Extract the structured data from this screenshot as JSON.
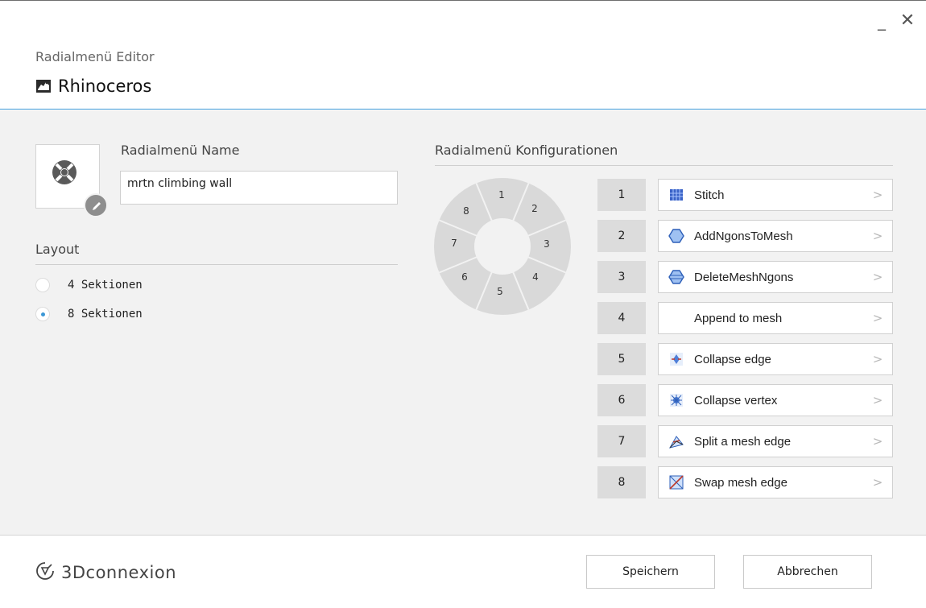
{
  "window": {
    "minimize_glyph": "_",
    "close_glyph": "✕",
    "subtitle": "Radialmenü Editor",
    "app_name": "Rhinoceros",
    "app_icon": "rhino-icon"
  },
  "name_section": {
    "label": "Radialmenü Name",
    "value": "mrtn climbing wall",
    "icon": "radial-menu-icon",
    "edit_icon": "pencil-icon"
  },
  "layout": {
    "label": "Layout",
    "options": [
      {
        "label": "4 Sektionen",
        "selected": false
      },
      {
        "label": "8 Sektionen",
        "selected": true
      }
    ]
  },
  "config": {
    "label": "Radialmenü Konfigurationen",
    "wheel_labels": [
      "1",
      "2",
      "3",
      "4",
      "5",
      "6",
      "7",
      "8"
    ],
    "slots": [
      {
        "num": "1",
        "label": "Stitch",
        "icon": "stitch-icon"
      },
      {
        "num": "2",
        "label": "AddNgonsToMesh",
        "icon": "hexagon-icon"
      },
      {
        "num": "3",
        "label": "DeleteMeshNgons",
        "icon": "hexagon-delete-icon"
      },
      {
        "num": "4",
        "label": "Append to mesh",
        "icon": ""
      },
      {
        "num": "5",
        "label": "Collapse edge",
        "icon": "collapse-edge-icon"
      },
      {
        "num": "6",
        "label": "Collapse vertex",
        "icon": "collapse-vertex-icon"
      },
      {
        "num": "7",
        "label": "Split a mesh edge",
        "icon": "split-edge-icon"
      },
      {
        "num": "8",
        "label": "Swap mesh edge",
        "icon": "swap-edge-icon"
      }
    ],
    "arrow_glyph": ">"
  },
  "footer": {
    "brand": "3Dconnexion",
    "brand_icon": "3dconnexion-logo",
    "save_label": "Speichern",
    "cancel_label": "Abbrechen"
  },
  "colors": {
    "accent": "#3c97d6",
    "content_bg": "#f2f2f2",
    "slot_num_bg": "#dcdcdc",
    "wheel": "#d8d8d8"
  }
}
